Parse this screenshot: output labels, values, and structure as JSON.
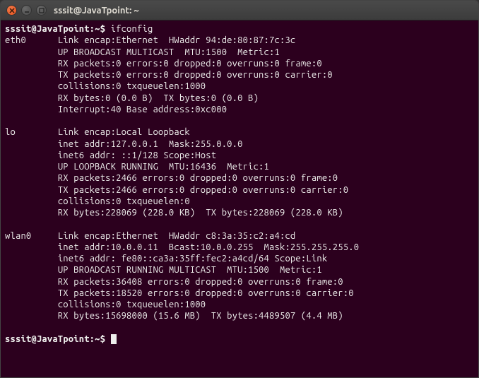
{
  "window": {
    "title": "sssit@JavaTpoint: ~"
  },
  "terminal": {
    "prompt": "sssit@JavaTpoint:~$ ",
    "command": "ifconfig",
    "output": {
      "eth0": {
        "name": "eth0",
        "l1": "Link encap:Ethernet  HWaddr 94:de:80:87:7c:3c",
        "l2": "UP BROADCAST MULTICAST  MTU:1500  Metric:1",
        "l3": "RX packets:0 errors:0 dropped:0 overruns:0 frame:0",
        "l4": "TX packets:0 errors:0 dropped:0 overruns:0 carrier:0",
        "l5": "collisions:0 txqueuelen:1000",
        "l6": "RX bytes:0 (0.0 B)  TX bytes:0 (0.0 B)",
        "l7": "Interrupt:40 Base address:0xc000"
      },
      "lo": {
        "name": "lo",
        "l1": "Link encap:Local Loopback",
        "l2": "inet addr:127.0.0.1  Mask:255.0.0.0",
        "l3": "inet6 addr: ::1/128 Scope:Host",
        "l4": "UP LOOPBACK RUNNING  MTU:16436  Metric:1",
        "l5": "RX packets:2466 errors:0 dropped:0 overruns:0 frame:0",
        "l6": "TX packets:2466 errors:0 dropped:0 overruns:0 carrier:0",
        "l7": "collisions:0 txqueuelen:0",
        "l8": "RX bytes:228069 (228.0 KB)  TX bytes:228069 (228.0 KB)"
      },
      "wlan0": {
        "name": "wlan0",
        "l1": "Link encap:Ethernet  HWaddr c8:3a:35:c2:a4:cd",
        "l2": "inet addr:10.0.0.11  Bcast:10.0.0.255  Mask:255.255.255.0",
        "l3": "inet6 addr: fe80::ca3a:35ff:fec2:a4cd/64 Scope:Link",
        "l4": "UP BROADCAST RUNNING MULTICAST  MTU:1500  Metric:1",
        "l5": "RX packets:36408 errors:0 dropped:0 overruns:0 frame:0",
        "l6": "TX packets:18520 errors:0 dropped:0 overruns:0 carrier:0",
        "l7": "collisions:0 txqueuelen:1000",
        "l8": "RX bytes:15698000 (15.6 MB)  TX bytes:4489507 (4.4 MB)"
      }
    }
  }
}
